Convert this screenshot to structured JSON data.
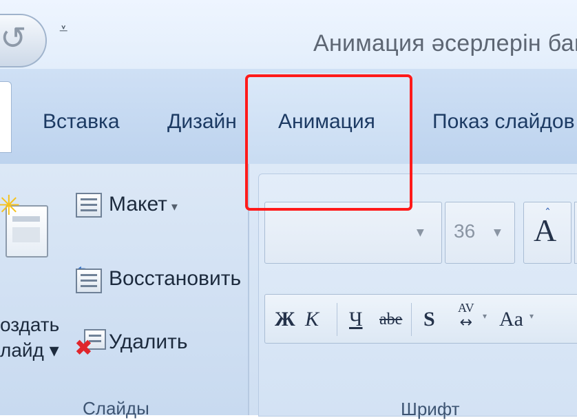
{
  "titlebar": {
    "undo_icon": "undo-icon",
    "qat_customize_icon": "qat-customize-icon",
    "title": "Анимация әсерлерін бап"
  },
  "tabs": [
    {
      "label": "Вставка"
    },
    {
      "label": "Дизайн"
    },
    {
      "label": "Анимация",
      "highlighted": true
    },
    {
      "label": "Показ слайдов"
    }
  ],
  "highlight_color": "#ff1a1a",
  "ribbon": {
    "slides": {
      "new_slide_line1": "оздать",
      "new_slide_line2": "лайд ▾",
      "layout": "Макет",
      "reset": "Восстановить",
      "delete": "Удалить",
      "group_label": "Слайды"
    },
    "font": {
      "font_name": "",
      "font_size": "36",
      "grow_glyph": "A",
      "bold": "Ж",
      "italic": "К",
      "underline": "Ч",
      "strike": "abe",
      "shadow": "S",
      "spacing_top": "AV",
      "spacing_bottom": "↔",
      "change_case": "Aa",
      "group_label": "Шрифт"
    }
  }
}
